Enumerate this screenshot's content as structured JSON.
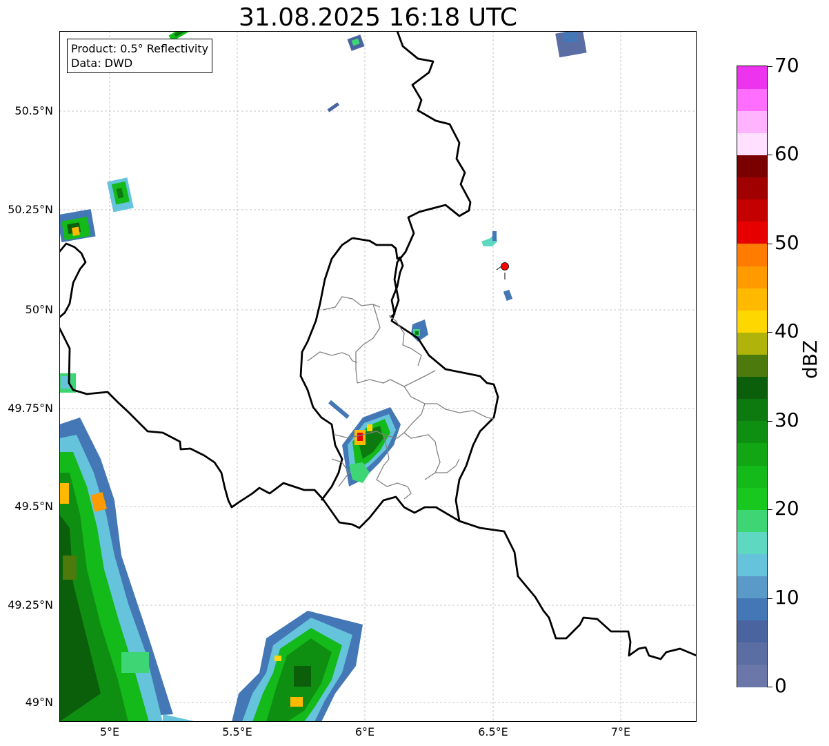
{
  "title": "31.08.2025 16:18 UTC",
  "info_box": {
    "line1": "Product: 0.5° Reflectivity",
    "line2": "Data: DWD"
  },
  "lat_labels": [
    "50.5°N",
    "50.25°N",
    "50°N",
    "49.75°N",
    "49.5°N",
    "49.25°N",
    "49°N"
  ],
  "lon_labels": [
    "5°E",
    "5.5°E",
    "6°E",
    "6.5°E",
    "7°E"
  ],
  "colorbar": {
    "unit": "dBZ",
    "ticks": [
      "0",
      "10",
      "20",
      "30",
      "40",
      "50",
      "60",
      "70"
    ],
    "colors": [
      "#6a77a8",
      "#5a6ea3",
      "#4a64a0",
      "#4377b5",
      "#5a9ac8",
      "#66c3dc",
      "#5ed8c0",
      "#3ed674",
      "#18c81f",
      "#14b91a",
      "#12a614",
      "#0f8f12",
      "#0d7a0f",
      "#0b5f0b",
      "#4c7a0c",
      "#b0b30a",
      "#ffd700",
      "#ffb900",
      "#ff9a00",
      "#ff7c00",
      "#e60000",
      "#c50000",
      "#a00000",
      "#7a0000",
      "#ffe0ff",
      "#ffb3ff",
      "#ff6eff",
      "#ee33ee"
    ]
  },
  "marker": {
    "color": "#ff0000"
  }
}
